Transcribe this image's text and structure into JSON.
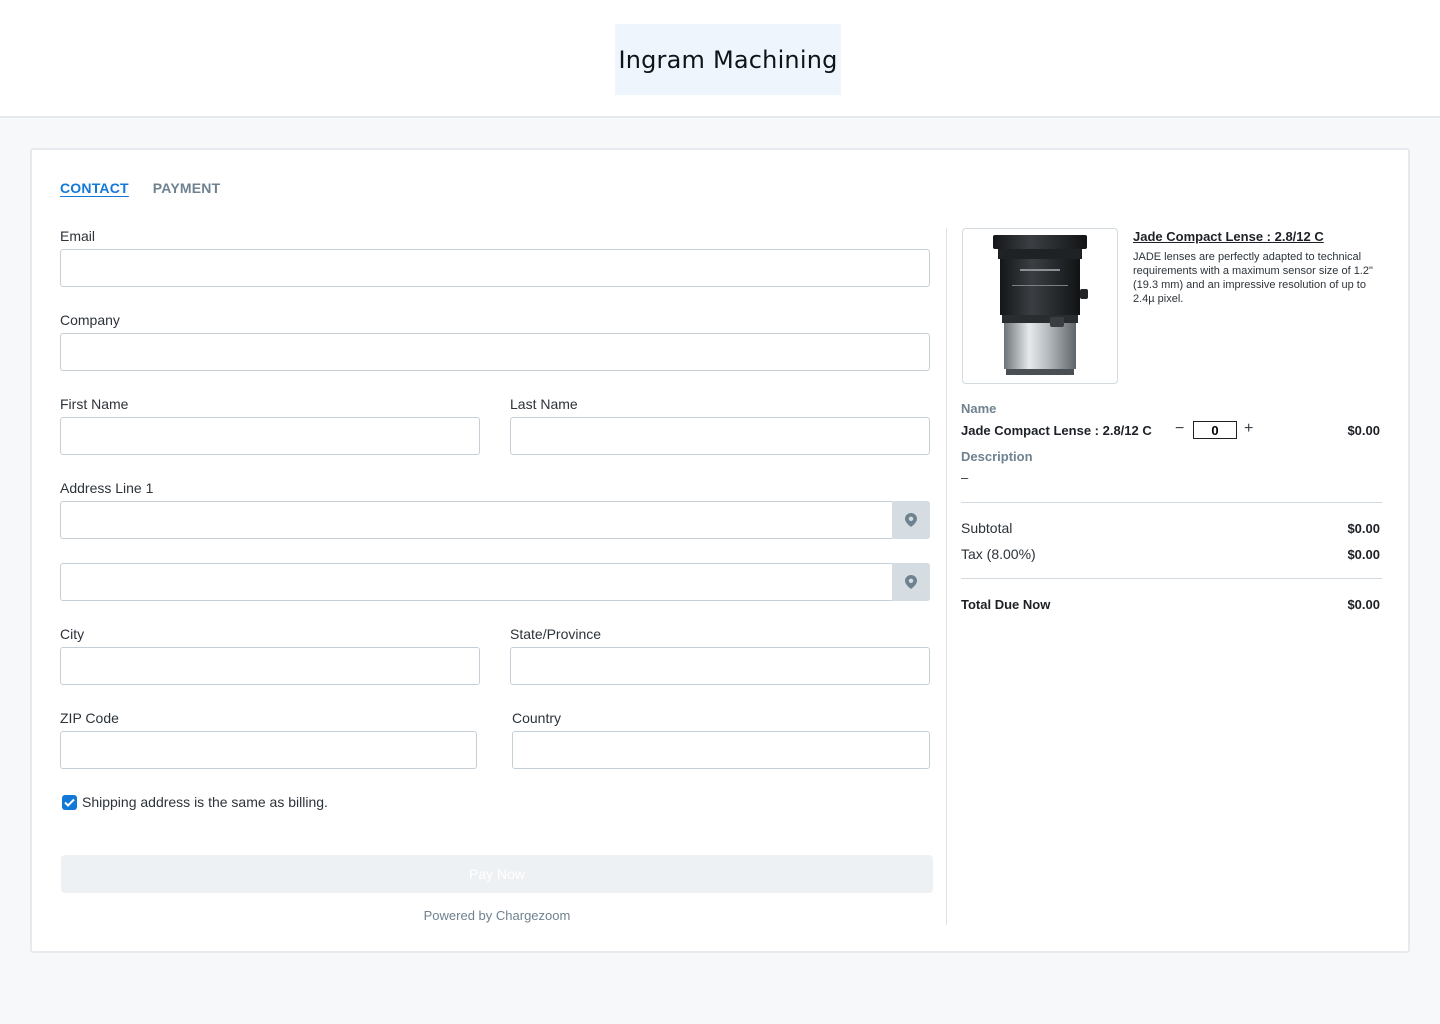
{
  "header": {
    "logo_text": "Ingram Machining"
  },
  "tabs": [
    {
      "label": "CONTACT",
      "active": true
    },
    {
      "label": "PAYMENT",
      "active": false
    }
  ],
  "form": {
    "email_label": "Email",
    "email_value": "",
    "company_label": "Company",
    "company_value": "",
    "first_name_label": "First Name",
    "first_name_value": "",
    "last_name_label": "Last Name",
    "last_name_value": "",
    "address1_label": "Address Line 1",
    "address1_value": "",
    "address2_value": "",
    "city_label": "City",
    "city_value": "",
    "state_label": "State/Province",
    "state_value": "",
    "zip_label": "ZIP Code",
    "zip_value": "",
    "country_label": "Country",
    "country_value": "",
    "shipping_same_label": "Shipping address is the same as billing.",
    "shipping_same_checked": true,
    "pay_button_label": "Pay Now",
    "powered_by": "Powered by Chargezoom",
    "location_icon": "map-pin-icon"
  },
  "summary": {
    "product_title": "Jade Compact Lense : 2.8/12 C",
    "product_description": "JADE lenses are perfectly adapted to technical requirements with a maximum sensor size of 1.2\" (19.3 mm) and an impressive resolution of up to 2.4µ pixel.",
    "name_label": "Name",
    "item_name": "Jade Compact Lense : 2.8/12 C",
    "quantity": "0",
    "minus_label": "−",
    "plus_label": "+",
    "item_price": "$0.00",
    "description_label": "Description",
    "description_value": "–",
    "subtotal_label": "Subtotal",
    "subtotal_value": "$0.00",
    "tax_label": "Tax (8.00%)",
    "tax_value": "$0.00",
    "total_label": "Total Due Now",
    "total_value": "$0.00"
  },
  "colors": {
    "accent": "#1279d8",
    "muted": "#6f8290",
    "background": "#f6f8fa"
  }
}
